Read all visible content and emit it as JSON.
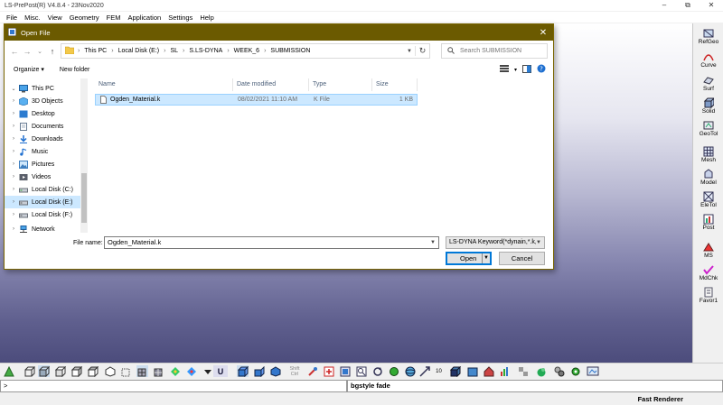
{
  "app": {
    "title": "LS-PrePost(R) V4.8.4 - 23Nov2020",
    "menu": [
      "File",
      "Misc.",
      "View",
      "Geometry",
      "FEM",
      "Application",
      "Settings",
      "Help"
    ],
    "window_controls": [
      "–",
      "⧉",
      "✕"
    ]
  },
  "right_panel": [
    "RefGeo",
    "Curve",
    "Surf",
    "Solid",
    "GeoTol",
    "Mesh",
    "Model",
    "EleTol",
    "Post",
    "MS",
    "MdChk",
    "Favor1"
  ],
  "bottom_toolbar": {
    "shift_label": "Shift",
    "ctrl_label": "Ctrl",
    "count_label": "10",
    "u_label": "U"
  },
  "command_line": ">",
  "message": "bgstyle fade",
  "status": {
    "renderer": "Fast Renderer"
  },
  "dialog": {
    "title": "Open File",
    "close": "✕",
    "nav_buttons": [
      "←",
      "→",
      "⌄",
      "↑"
    ],
    "breadcrumb": [
      "This PC",
      "Local Disk (E:)",
      "SL",
      "S.LS-DYNA",
      "WEEK_6",
      "SUBMISSION"
    ],
    "search_placeholder": "Search SUBMISSION",
    "organize_label": "Organize ▾",
    "new_folder_label": "New folder",
    "nav_items": [
      {
        "label": "This PC",
        "chevron": "⌄",
        "icon": "pc",
        "selected": false
      },
      {
        "label": "3D Objects",
        "chevron": "›",
        "icon": "objects3d",
        "selected": false
      },
      {
        "label": "Desktop",
        "chevron": "›",
        "icon": "desktop",
        "selected": false
      },
      {
        "label": "Documents",
        "chevron": "›",
        "icon": "documents",
        "selected": false
      },
      {
        "label": "Downloads",
        "chevron": "›",
        "icon": "downloads",
        "selected": false
      },
      {
        "label": "Music",
        "chevron": "›",
        "icon": "music",
        "selected": false
      },
      {
        "label": "Pictures",
        "chevron": "›",
        "icon": "pictures",
        "selected": false
      },
      {
        "label": "Videos",
        "chevron": "›",
        "icon": "videos",
        "selected": false
      },
      {
        "label": "Local Disk (C:)",
        "chevron": "›",
        "icon": "drive",
        "selected": false
      },
      {
        "label": "Local Disk (E:)",
        "chevron": "›",
        "icon": "drive",
        "selected": true
      },
      {
        "label": "Local Disk (F:)",
        "chevron": "›",
        "icon": "drive",
        "selected": false
      },
      {
        "label": "Network",
        "chevron": "›",
        "icon": "network",
        "selected": false
      }
    ],
    "columns": [
      "Name",
      "Date modified",
      "Type",
      "Size"
    ],
    "files": [
      {
        "name": "Ogden_Material.k",
        "date": "08/02/2021 11:10 AM",
        "type": "K File",
        "size": "1 KB"
      }
    ],
    "filename_label": "File name:",
    "filename_value": "Ogden_Material.k",
    "filetype_value": "LS-DYNA Keyword(*dynain,*.k,",
    "open_label": "Open",
    "cancel_label": "Cancel"
  }
}
